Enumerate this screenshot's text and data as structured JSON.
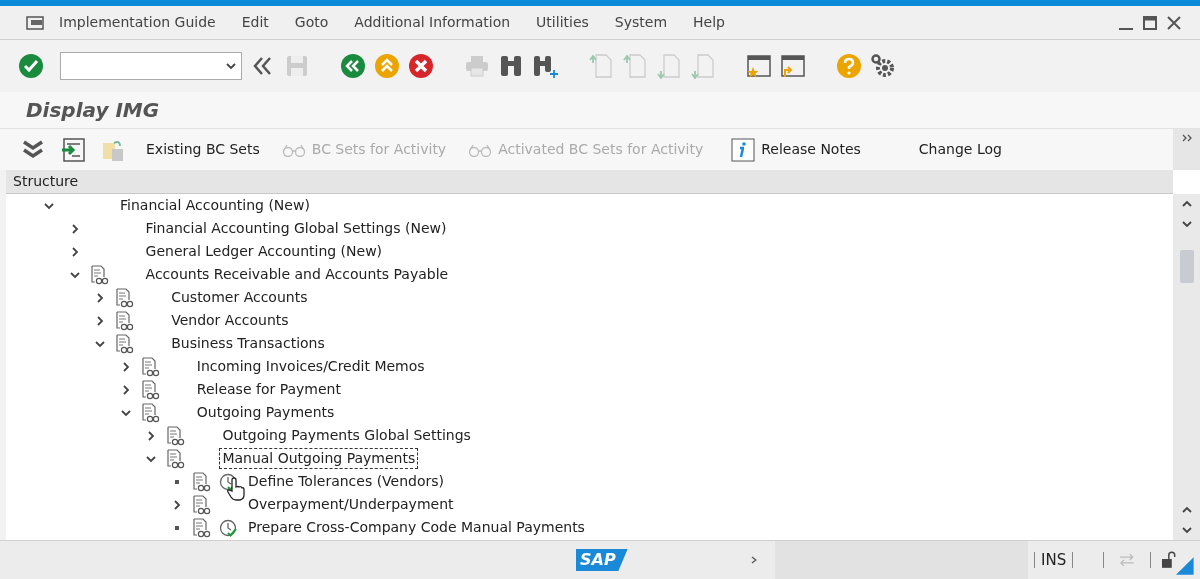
{
  "menu": [
    {
      "label": "Implementation Guide"
    },
    {
      "label": "Edit"
    },
    {
      "label": "Goto"
    },
    {
      "label": "Additional Information"
    },
    {
      "label": "Utilities"
    },
    {
      "label": "System"
    },
    {
      "label": "Help"
    }
  ],
  "title": "Display IMG",
  "app_toolbar": [
    {
      "label": "Existing BC Sets",
      "kind": "plain",
      "disabled": false
    },
    {
      "label": "BC Sets for Activity",
      "kind": "glasses",
      "disabled": true
    },
    {
      "label": "Activated BC Sets for Activity",
      "kind": "glasses",
      "disabled": true
    },
    {
      "label": "Release Notes",
      "kind": "info",
      "disabled": false
    },
    {
      "label": "Change Log",
      "kind": "plain",
      "disabled": false
    }
  ],
  "tree": {
    "header": "Structure",
    "nodes": [
      {
        "label": "Financial Accounting (New)",
        "kind": "group",
        "expanded": true,
        "selected": false,
        "children": [
          {
            "label": "Financial Accounting Global Settings (New)",
            "kind": "group",
            "expanded": false,
            "selected": false
          },
          {
            "label": "General Ledger Accounting (New)",
            "kind": "group",
            "expanded": false,
            "selected": false
          },
          {
            "label": "Accounts Receivable and Accounts Payable",
            "kind": "node",
            "expanded": true,
            "selected": false,
            "children": [
              {
                "label": "Customer Accounts",
                "kind": "node",
                "expanded": false,
                "selected": false
              },
              {
                "label": "Vendor Accounts",
                "kind": "node",
                "expanded": false,
                "selected": false
              },
              {
                "label": "Business Transactions",
                "kind": "node",
                "expanded": true,
                "selected": false,
                "children": [
                  {
                    "label": "Incoming Invoices/Credit Memos",
                    "kind": "node",
                    "expanded": false,
                    "selected": false
                  },
                  {
                    "label": "Release for Payment",
                    "kind": "node",
                    "expanded": false,
                    "selected": false
                  },
                  {
                    "label": "Outgoing Payments",
                    "kind": "node",
                    "expanded": true,
                    "selected": false,
                    "children": [
                      {
                        "label": "Outgoing Payments Global Settings",
                        "kind": "node",
                        "expanded": false,
                        "selected": false
                      },
                      {
                        "label": "Manual Outgoing Payments",
                        "kind": "node",
                        "expanded": true,
                        "selected": true,
                        "children": [
                          {
                            "label": "Define Tolerances (Vendors)",
                            "kind": "activity",
                            "selected": false
                          },
                          {
                            "label": "Overpayment/Underpayment",
                            "kind": "node",
                            "expanded": false,
                            "selected": false
                          },
                          {
                            "label": "Prepare Cross-Company Code Manual Payments",
                            "kind": "activity",
                            "selected": false
                          }
                        ]
                      }
                    ]
                  }
                ]
              }
            ]
          }
        ]
      }
    ]
  },
  "status_bar": {
    "logo": "SAP",
    "mode": "INS"
  }
}
